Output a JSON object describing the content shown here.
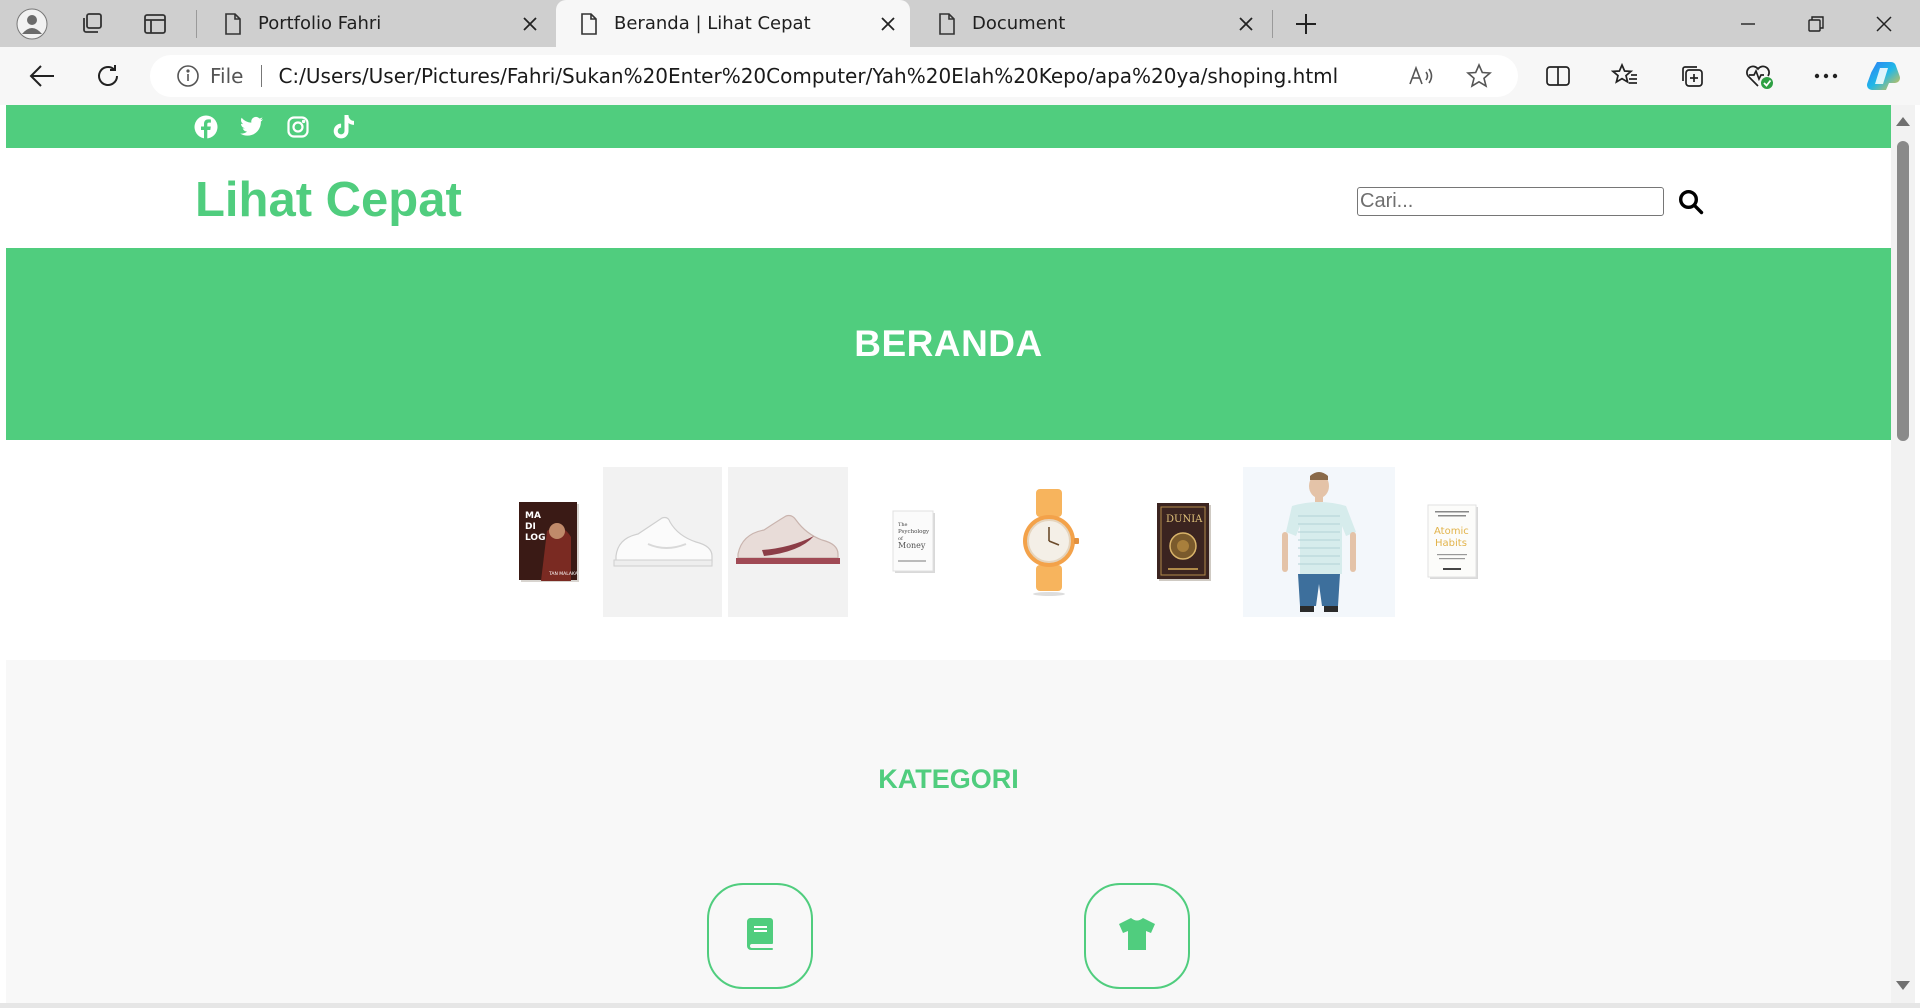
{
  "browser": {
    "tabs": [
      {
        "title": "Portfolio Fahri",
        "active": false
      },
      {
        "title": "Beranda | Lihat Cepat",
        "active": true
      },
      {
        "title": "Document",
        "active": false
      }
    ],
    "address": {
      "scheme_label": "File",
      "url": "C:/Users/User/Pictures/Fahri/Sukan%20Enter%20Computer/Yah%20Elah%20Kepo/apa%20ya/shoping.html"
    }
  },
  "page": {
    "social_icons": [
      "facebook-icon",
      "twitter-icon",
      "instagram-icon",
      "tiktok-icon"
    ],
    "logo": "Lihat Cepat",
    "search": {
      "placeholder": "Cari..."
    },
    "hero_title": "BERANDA",
    "gallery": [
      {
        "name": "book-madilog",
        "text": "MA DI LOG",
        "sub": "TAN MALAKA"
      },
      {
        "name": "shoe-white"
      },
      {
        "name": "shoe-pink"
      },
      {
        "name": "book-psychology-of-money",
        "text": "The Psychology of Money"
      },
      {
        "name": "watch-orange"
      },
      {
        "name": "book-dunia",
        "text": "DUNIA"
      },
      {
        "name": "tshirt-model"
      },
      {
        "name": "book-atomic-habits",
        "text": "Atomic Habits"
      }
    ],
    "kategori_title": "KATEGORI",
    "categories": [
      {
        "name": "book-icon"
      },
      {
        "name": "tshirt-icon"
      }
    ]
  },
  "colors": {
    "brand_green": "#50cd7e",
    "white": "#ffffff",
    "section_gray": "#f8f8f8"
  }
}
